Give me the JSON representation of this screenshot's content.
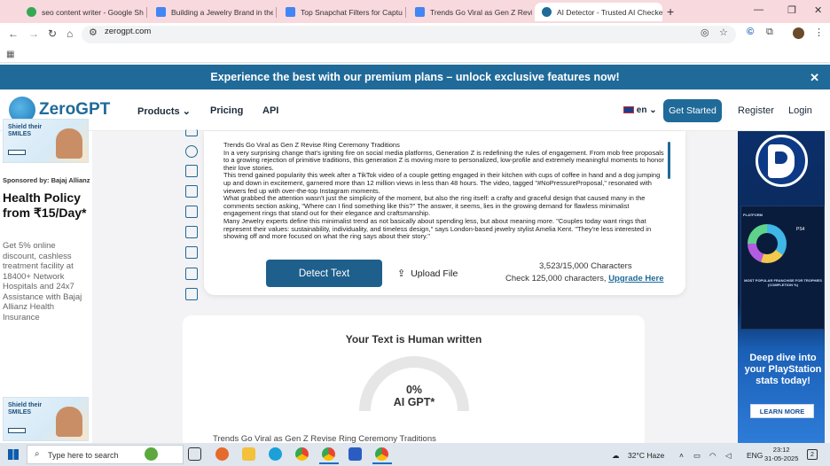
{
  "browser": {
    "tabs": [
      {
        "title": "seo content writer - Google Sh",
        "icon": "google-icon",
        "color": "#34a853"
      },
      {
        "title": "Building a Jewelry Brand in the",
        "icon": "docs-icon",
        "color": "#4285f4"
      },
      {
        "title": "Top Snapchat Filters for Captur",
        "icon": "docs-icon",
        "color": "#4285f4"
      },
      {
        "title": "Trends Go Viral as Gen Z Revis",
        "icon": "docs-icon",
        "color": "#4285f4"
      },
      {
        "title": "AI Detector - Trusted AI Checke",
        "icon": "zerogpt-icon",
        "color": "#1f6a99"
      }
    ],
    "url": "zerogpt.com"
  },
  "promo": {
    "text": "Experience the best with our premium plans – unlock exclusive features now!",
    "close": "✕"
  },
  "header": {
    "logo": "ZeroGPT",
    "nav": [
      "Products",
      "Pricing",
      "API"
    ],
    "products_caret": "⌄",
    "language": "en",
    "get_started": "Get Started",
    "register": "Register",
    "login": "Login"
  },
  "ad_left": {
    "image_text": "Shield their SMILES",
    "sponsored": "Sponsored by: Bajaj Allianz",
    "headline": "Health Policy from ₹15/Day*",
    "body": "Get 5% online discount, cashless treatment facility at 18400+ Network Hospitals and 24x7 Assistance with Bajaj Allianz Health Insurance"
  },
  "editor": {
    "paragraphs": [
      "Trends Go Viral as Gen Z Revise Ring Ceremony Traditions",
      "In a very surprising change that's igniting fire on social media platforms, Generation Z is redefining the rules of engagement. From mob free proposals to a growing rejection of primitive traditions, this generation Z is moving more to personalized, low-profile and extremely meaningful moments to honor their love stories.",
      "This trend gained popularity this week after a TikTok video of a couple getting engaged in their kitchen with cups of coffee in hand and a dog jumping up and down in excitement, garnered more than 12 million views in less than 48 hours. The video, tagged \"#NoPressureProposal,\" resonated with viewers fed up with over-the-top Instagram moments.",
      "What grabbed the attention wasn't just the simplicity of the moment, but also the ring itself: a crafty and graceful design that caused many in the comments section asking, \"Where can I find something like this?\" The answer, it seems, lies in the growing demand for flawless minimalist engagement rings that stand out for their elegance and craftsmanship.",
      "Many Jewelry experts define this minimalist trend as not basically about spending less, but about meaning more. \"Couples today want rings that represent their values: sustainability, individuality, and timeless design,\" says London-based jewelry stylist Amelia Kent. \"They're less interested in showing off and more focused on what the ring says about their story.\""
    ],
    "detect_button": "Detect Text",
    "upload_button": "Upload File",
    "char_count": "3,523/15,000 Characters",
    "check_text": "Check 125,000 characters,",
    "upgrade_link": "Upgrade Here"
  },
  "result": {
    "title": "Your Text is Human written",
    "percent": 0,
    "percent_label": "0%",
    "gauge_label": "AI GPT*",
    "subtitle": "Trends Go Viral as Gen Z Revise Ring Ceremony Traditions"
  },
  "ad_right": {
    "platform_label": "PLATFORM",
    "console": "PS4",
    "franchise_text": "MOST POPULAR FRANCHISE FOR TROPHIES (COMPLETION %)",
    "headline": "Deep dive into your PlayStation stats today!",
    "button": "LEARN MORE"
  },
  "taskbar": {
    "search_placeholder": "Type here to search",
    "weather": "32°C  Haze",
    "language": "ENG",
    "time": "23:12",
    "date": "31-05-2025",
    "notifications": "2"
  }
}
